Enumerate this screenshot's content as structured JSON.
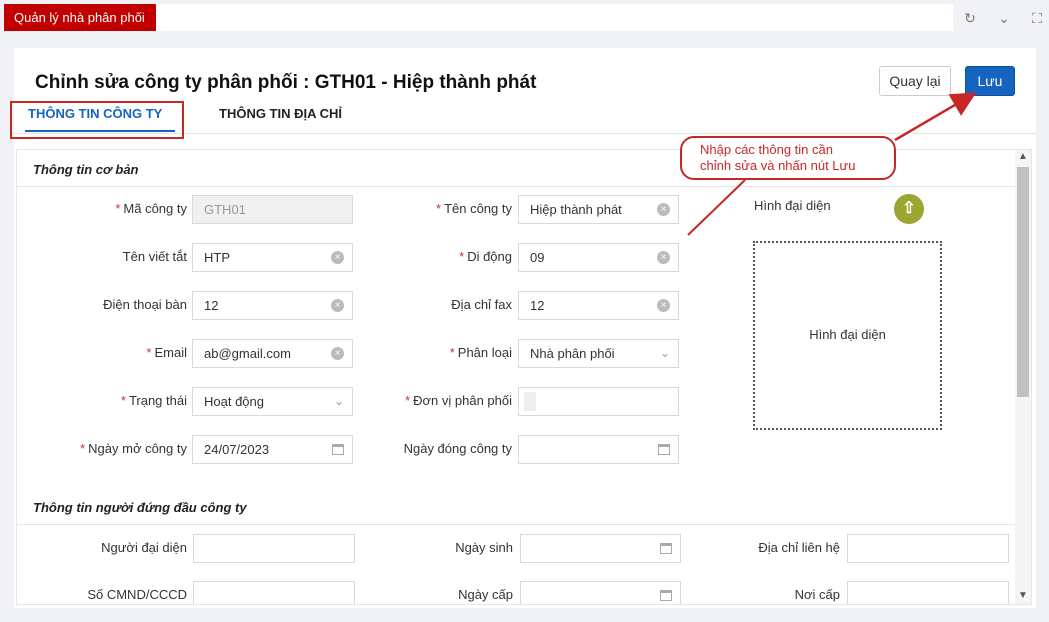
{
  "app": {
    "module_tab": "Quản lý nhà phân phối",
    "toolbar_icons": [
      "refresh-icon",
      "chevron-down-icon",
      "expand-icon"
    ]
  },
  "page": {
    "title": "Chỉnh sửa công ty phân phối : GTH01 - Hiệp thành phát",
    "back_label": "Quay lại",
    "save_label": "Lưu",
    "accent_color": "#1565c0",
    "annotation_color": "#c62828"
  },
  "tabs": [
    {
      "label": "THÔNG TIN CÔNG TY",
      "active": true
    },
    {
      "label": "THÔNG TIN ĐỊA CHỈ",
      "active": false
    }
  ],
  "basic": {
    "section_title": "Thông tin cơ bản",
    "ma_cong_ty": {
      "label": "Mã công ty",
      "required": "*",
      "value": "GTH01"
    },
    "ten_cong_ty": {
      "label": "Tên công ty",
      "required": "*",
      "value": "Hiệp thành phát"
    },
    "ten_viet_tat": {
      "label": "Tên viết tắt",
      "value": "HTP"
    },
    "di_dong": {
      "label": "Di động",
      "required": "*",
      "value": "09"
    },
    "dien_thoai_ban": {
      "label": "Điện thoại bàn",
      "value": "12"
    },
    "dia_chi_fax": {
      "label": "Địa chỉ fax",
      "value": "12"
    },
    "email": {
      "label": "Email",
      "required": "*",
      "value": "ab@gmail.com"
    },
    "phan_loai": {
      "label": "Phân loại",
      "required": "*",
      "value": "Nhà phân phối"
    },
    "trang_thai": {
      "label": "Trạng thái",
      "required": "*",
      "value": "Hoạt động"
    },
    "don_vi_phan_phoi": {
      "label": "Đơn vị phân phối",
      "required": "*",
      "value": ""
    },
    "ngay_mo": {
      "label": "Ngày mở công ty",
      "required": "*",
      "value": "24/07/2023"
    },
    "ngay_dong": {
      "label": "Ngày đóng công ty",
      "value": ""
    },
    "avatar_label": "Hình đại diện",
    "avatar_placeholder": "Hình đại diện"
  },
  "head": {
    "section_title": "Thông tin người đứng đầu công ty",
    "nguoi_dai_dien": {
      "label": "Người đại diện",
      "value": ""
    },
    "ngay_sinh": {
      "label": "Ngày sinh",
      "value": ""
    },
    "dia_chi_lien_he": {
      "label": "Địa chỉ liên hệ",
      "value": ""
    },
    "cmnd": {
      "label": "Số CMND/CCCD",
      "value": ""
    },
    "ngay_cap": {
      "label": "Ngày cấp",
      "value": ""
    },
    "noi_cap": {
      "label": "Nơi cấp",
      "value": ""
    }
  },
  "callout": {
    "line1": "Nhập các thông tin cần",
    "line2": "chỉnh sửa và nhấn nút Lưu"
  }
}
